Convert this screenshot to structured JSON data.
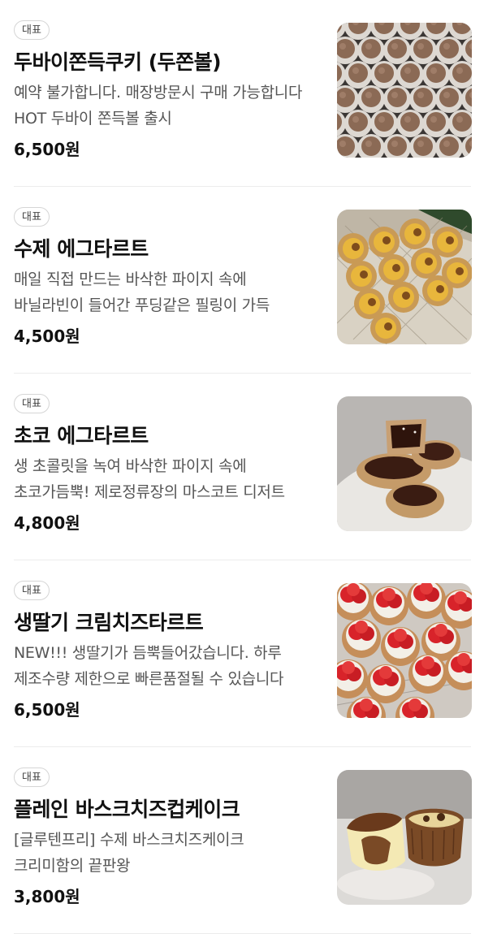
{
  "menu": {
    "items": [
      {
        "badge": "대표",
        "name": "두바이쫀득쿠키 (두쫀볼)",
        "description": "예약 불가합니다. 매장방문시 구매 가능합니다 HOT 두바이 쫀득볼 출시",
        "price": "6,500원",
        "image_icon": "cocoa-ball-cookies-photo"
      },
      {
        "badge": "대표",
        "name": "수제 에그타르트",
        "description": "매일 직접 만드는 바삭한 파이지 속에 바닐라빈이 들어간 푸딩같은 필링이 가득",
        "price": "4,500원",
        "image_icon": "egg-tart-photo"
      },
      {
        "badge": "대표",
        "name": "초코 에그타르트",
        "description": "생 초콜릿을 녹여 바삭한 파이지 속에 초코가듬뿍! 제로정류장의 마스코트 디저트",
        "price": "4,800원",
        "image_icon": "choco-tart-photo"
      },
      {
        "badge": "대표",
        "name": "생딸기 크림치즈타르트",
        "description": "NEW!!! 생딸기가 듬뿍들어갔습니다. 하루 제조수량 제한으로 빠른품절될 수 있습니다",
        "price": "6,500원",
        "image_icon": "strawberry-tart-photo"
      },
      {
        "badge": "대표",
        "name": "플레인 바스크치즈컵케이크",
        "description": "[글루텐프리] 수제 바스크치즈케이크 크리미함의 끝판왕",
        "price": "3,800원",
        "image_icon": "basque-cheesecake-photo"
      }
    ]
  }
}
